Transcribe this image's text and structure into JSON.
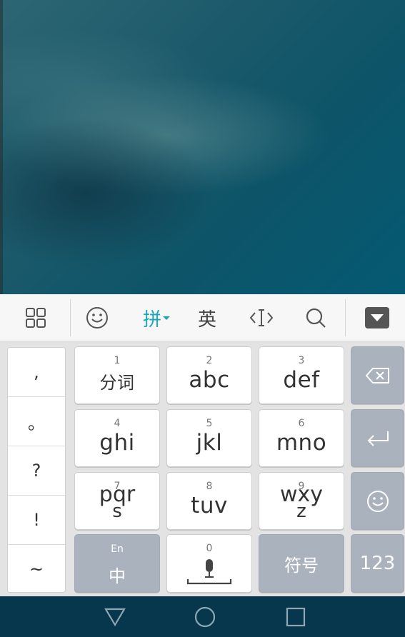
{
  "toolbar": {
    "pinyin_label": "拼",
    "english_label": "英",
    "icons": [
      "apps-grid-icon",
      "emoji-icon",
      "cursor-edit-icon",
      "search-icon",
      "hide-keyboard-icon"
    ]
  },
  "punctuation": [
    ",",
    "。",
    "?",
    "!",
    "~"
  ],
  "keys": [
    {
      "num": "1",
      "label": "分词"
    },
    {
      "num": "2",
      "label": "abc"
    },
    {
      "num": "3",
      "label": "def"
    },
    {
      "num": "4",
      "label": "ghi"
    },
    {
      "num": "5",
      "label": "jkl"
    },
    {
      "num": "6",
      "label": "mno"
    },
    {
      "num": "7",
      "label": "pqr",
      "sub": "s"
    },
    {
      "num": "8",
      "label": "tuv"
    },
    {
      "num": "9",
      "label": "wxy",
      "sub": "z"
    }
  ],
  "bottom_row": {
    "lang_small": "En",
    "lang_main": "中",
    "space_num": "0",
    "symbols_label": "符号",
    "numbers_label": "123"
  },
  "side_keys": [
    "backspace-icon",
    "enter-icon",
    "emoji-icon"
  ],
  "navbar": [
    "back-triangle-icon",
    "home-circle-icon",
    "recents-square-icon"
  ],
  "colors": {
    "accent": "#19a6b6",
    "function_key": "#a9b2bd",
    "navbar": "#06374c"
  }
}
